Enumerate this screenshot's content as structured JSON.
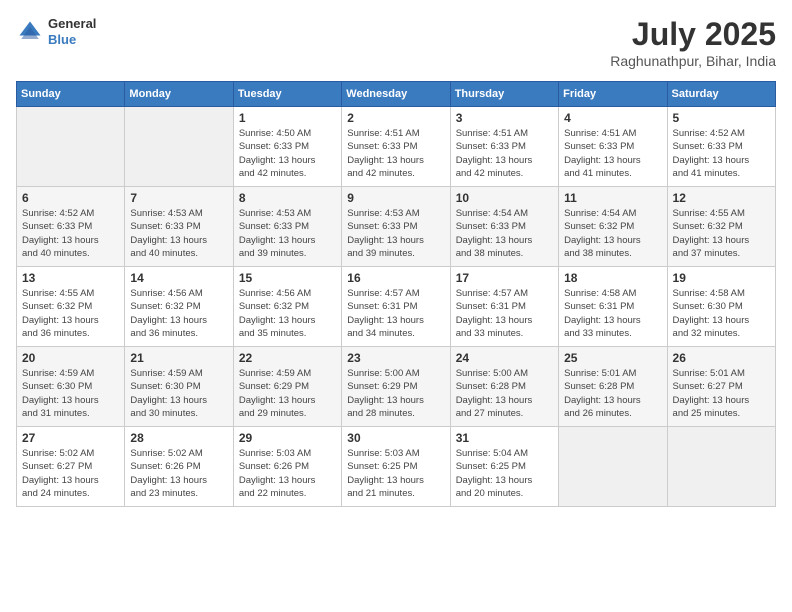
{
  "logo": {
    "line1": "General",
    "line2": "Blue"
  },
  "title": "July 2025",
  "location": "Raghunathpur, Bihar, India",
  "headers": [
    "Sunday",
    "Monday",
    "Tuesday",
    "Wednesday",
    "Thursday",
    "Friday",
    "Saturday"
  ],
  "weeks": [
    [
      {
        "day": "",
        "detail": ""
      },
      {
        "day": "",
        "detail": ""
      },
      {
        "day": "1",
        "detail": "Sunrise: 4:50 AM\nSunset: 6:33 PM\nDaylight: 13 hours\nand 42 minutes."
      },
      {
        "day": "2",
        "detail": "Sunrise: 4:51 AM\nSunset: 6:33 PM\nDaylight: 13 hours\nand 42 minutes."
      },
      {
        "day": "3",
        "detail": "Sunrise: 4:51 AM\nSunset: 6:33 PM\nDaylight: 13 hours\nand 42 minutes."
      },
      {
        "day": "4",
        "detail": "Sunrise: 4:51 AM\nSunset: 6:33 PM\nDaylight: 13 hours\nand 41 minutes."
      },
      {
        "day": "5",
        "detail": "Sunrise: 4:52 AM\nSunset: 6:33 PM\nDaylight: 13 hours\nand 41 minutes."
      }
    ],
    [
      {
        "day": "6",
        "detail": "Sunrise: 4:52 AM\nSunset: 6:33 PM\nDaylight: 13 hours\nand 40 minutes."
      },
      {
        "day": "7",
        "detail": "Sunrise: 4:53 AM\nSunset: 6:33 PM\nDaylight: 13 hours\nand 40 minutes."
      },
      {
        "day": "8",
        "detail": "Sunrise: 4:53 AM\nSunset: 6:33 PM\nDaylight: 13 hours\nand 39 minutes."
      },
      {
        "day": "9",
        "detail": "Sunrise: 4:53 AM\nSunset: 6:33 PM\nDaylight: 13 hours\nand 39 minutes."
      },
      {
        "day": "10",
        "detail": "Sunrise: 4:54 AM\nSunset: 6:33 PM\nDaylight: 13 hours\nand 38 minutes."
      },
      {
        "day": "11",
        "detail": "Sunrise: 4:54 AM\nSunset: 6:32 PM\nDaylight: 13 hours\nand 38 minutes."
      },
      {
        "day": "12",
        "detail": "Sunrise: 4:55 AM\nSunset: 6:32 PM\nDaylight: 13 hours\nand 37 minutes."
      }
    ],
    [
      {
        "day": "13",
        "detail": "Sunrise: 4:55 AM\nSunset: 6:32 PM\nDaylight: 13 hours\nand 36 minutes."
      },
      {
        "day": "14",
        "detail": "Sunrise: 4:56 AM\nSunset: 6:32 PM\nDaylight: 13 hours\nand 36 minutes."
      },
      {
        "day": "15",
        "detail": "Sunrise: 4:56 AM\nSunset: 6:32 PM\nDaylight: 13 hours\nand 35 minutes."
      },
      {
        "day": "16",
        "detail": "Sunrise: 4:57 AM\nSunset: 6:31 PM\nDaylight: 13 hours\nand 34 minutes."
      },
      {
        "day": "17",
        "detail": "Sunrise: 4:57 AM\nSunset: 6:31 PM\nDaylight: 13 hours\nand 33 minutes."
      },
      {
        "day": "18",
        "detail": "Sunrise: 4:58 AM\nSunset: 6:31 PM\nDaylight: 13 hours\nand 33 minutes."
      },
      {
        "day": "19",
        "detail": "Sunrise: 4:58 AM\nSunset: 6:30 PM\nDaylight: 13 hours\nand 32 minutes."
      }
    ],
    [
      {
        "day": "20",
        "detail": "Sunrise: 4:59 AM\nSunset: 6:30 PM\nDaylight: 13 hours\nand 31 minutes."
      },
      {
        "day": "21",
        "detail": "Sunrise: 4:59 AM\nSunset: 6:30 PM\nDaylight: 13 hours\nand 30 minutes."
      },
      {
        "day": "22",
        "detail": "Sunrise: 4:59 AM\nSunset: 6:29 PM\nDaylight: 13 hours\nand 29 minutes."
      },
      {
        "day": "23",
        "detail": "Sunrise: 5:00 AM\nSunset: 6:29 PM\nDaylight: 13 hours\nand 28 minutes."
      },
      {
        "day": "24",
        "detail": "Sunrise: 5:00 AM\nSunset: 6:28 PM\nDaylight: 13 hours\nand 27 minutes."
      },
      {
        "day": "25",
        "detail": "Sunrise: 5:01 AM\nSunset: 6:28 PM\nDaylight: 13 hours\nand 26 minutes."
      },
      {
        "day": "26",
        "detail": "Sunrise: 5:01 AM\nSunset: 6:27 PM\nDaylight: 13 hours\nand 25 minutes."
      }
    ],
    [
      {
        "day": "27",
        "detail": "Sunrise: 5:02 AM\nSunset: 6:27 PM\nDaylight: 13 hours\nand 24 minutes."
      },
      {
        "day": "28",
        "detail": "Sunrise: 5:02 AM\nSunset: 6:26 PM\nDaylight: 13 hours\nand 23 minutes."
      },
      {
        "day": "29",
        "detail": "Sunrise: 5:03 AM\nSunset: 6:26 PM\nDaylight: 13 hours\nand 22 minutes."
      },
      {
        "day": "30",
        "detail": "Sunrise: 5:03 AM\nSunset: 6:25 PM\nDaylight: 13 hours\nand 21 minutes."
      },
      {
        "day": "31",
        "detail": "Sunrise: 5:04 AM\nSunset: 6:25 PM\nDaylight: 13 hours\nand 20 minutes."
      },
      {
        "day": "",
        "detail": ""
      },
      {
        "day": "",
        "detail": ""
      }
    ]
  ]
}
